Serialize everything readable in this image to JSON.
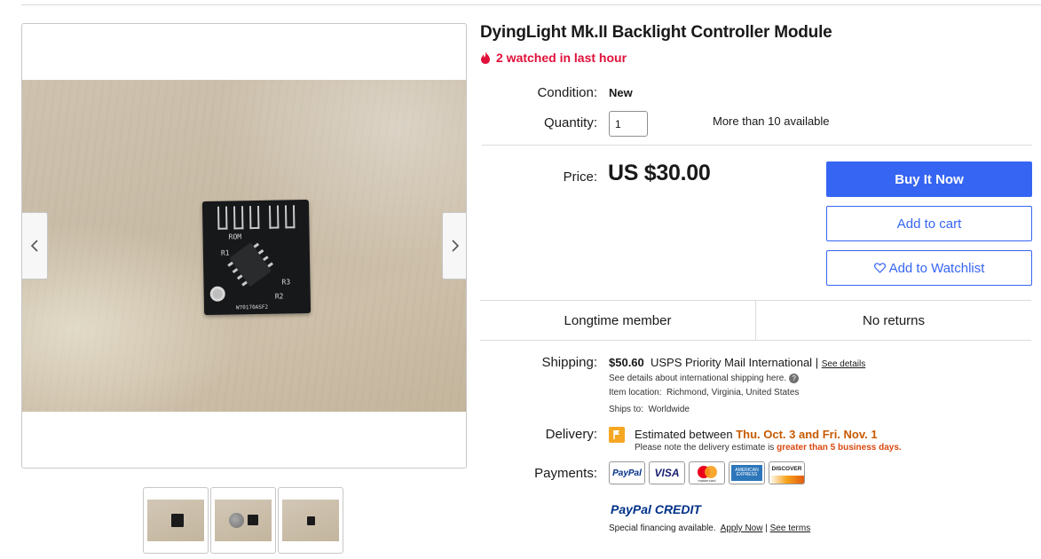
{
  "listing": {
    "title": "DyingLight Mk.II Backlight Controller Module",
    "watch_text": "2 watched in last hour"
  },
  "gallery": {
    "silk_labels": [
      "ROM",
      "R1",
      "R3",
      "R2",
      "W70170ASF2"
    ],
    "prev_icon": "chevron-left-icon",
    "next_icon": "chevron-right-icon"
  },
  "details": {
    "condition_label": "Condition:",
    "condition_value": "New",
    "quantity_label": "Quantity:",
    "quantity_value": "1",
    "availability": "More than 10 available",
    "price_label": "Price:",
    "price_value": "US $30.00"
  },
  "actions": {
    "buy_now": "Buy It Now",
    "add_to_cart": "Add to cart",
    "watchlist": "Add to Watchlist"
  },
  "badges": [
    "Longtime member",
    "No returns"
  ],
  "shipping": {
    "label": "Shipping:",
    "cost": "$50.60",
    "service": "USPS Priority Mail International",
    "separator": "|",
    "see_details": "See details",
    "intl_note": "See details about international shipping here.",
    "item_location_label": "Item location:",
    "item_location": "Richmond, Virginia, United States",
    "ships_to_label": "Ships to:",
    "ships_to": "Worldwide"
  },
  "delivery": {
    "label": "Delivery:",
    "estimated_prefix": "Estimated between",
    "estimated_dates": "Thu. Oct. 3 and Fri. Nov. 1",
    "note_prefix": "Please note the delivery estimate is",
    "note_emphasis": "greater than 5 business days."
  },
  "payments": {
    "label": "Payments:",
    "methods": [
      "PayPal",
      "VISA",
      "Mastercard",
      "American Express",
      "Discover"
    ],
    "paypal_text": "PayPal",
    "visa_text": "VISA",
    "mastercard_text": "mastercard",
    "amex_text": "AMERICAN EXPRESS",
    "discover_text": "DISCOVER",
    "paypal_credit_pay": "PayPal",
    "paypal_credit_word": "CREDIT",
    "financing_text": "Special financing available.",
    "apply_now": "Apply Now",
    "divider": "|",
    "see_terms": "See terms"
  },
  "colors": {
    "primary": "#3665f3",
    "watch_red": "#e0103a",
    "delivery_orange": "#c75a00",
    "paypal_dark": "#003087",
    "paypal_light": "#009cde"
  }
}
